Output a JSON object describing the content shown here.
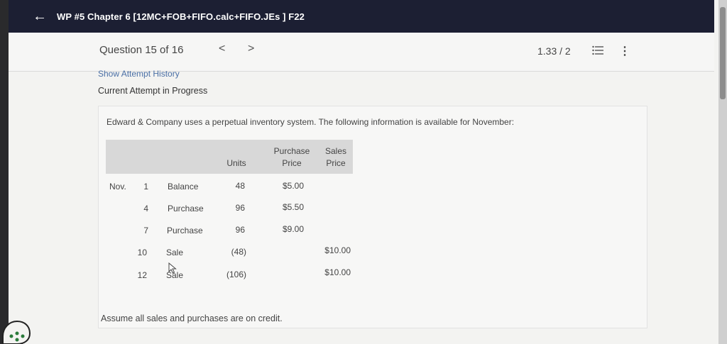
{
  "header": {
    "title": "WP #5 Chapter 6 [12MC+FOB+FIFO.calc+FIFO.JEs ] F22"
  },
  "question_nav": {
    "label": "Question 15 of 16",
    "prev": "<",
    "next": ">",
    "score": "1.33 / 2"
  },
  "attempt": {
    "link": "Show Attempt History",
    "status": "Current Attempt in Progress"
  },
  "problem": {
    "intro": "Edward & Company uses a perpetual inventory system. The following information is available for November:",
    "headers": {
      "units": "Units",
      "purchase_line1": "Purchase",
      "purchase_line2": "Price",
      "sales_line1": "Sales",
      "sales_line2": "Price"
    },
    "month": "Nov.",
    "rows": [
      {
        "day": "1",
        "desc": "Balance",
        "units": "48",
        "purchase": "$5.00",
        "sales": ""
      },
      {
        "day": "4",
        "desc": "Purchase",
        "units": "96",
        "purchase": "$5.50",
        "sales": ""
      },
      {
        "day": "7",
        "desc": "Purchase",
        "units": "96",
        "purchase": "$9.00",
        "sales": ""
      },
      {
        "day": "10",
        "desc": "Sale",
        "units": "(48)",
        "purchase": "",
        "sales": "$10.00"
      },
      {
        "day": "12",
        "desc": "Sale",
        "units": "(106)",
        "purchase": "",
        "sales": "$10.00"
      }
    ],
    "footer": "Assume all sales and purchases are on credit."
  }
}
